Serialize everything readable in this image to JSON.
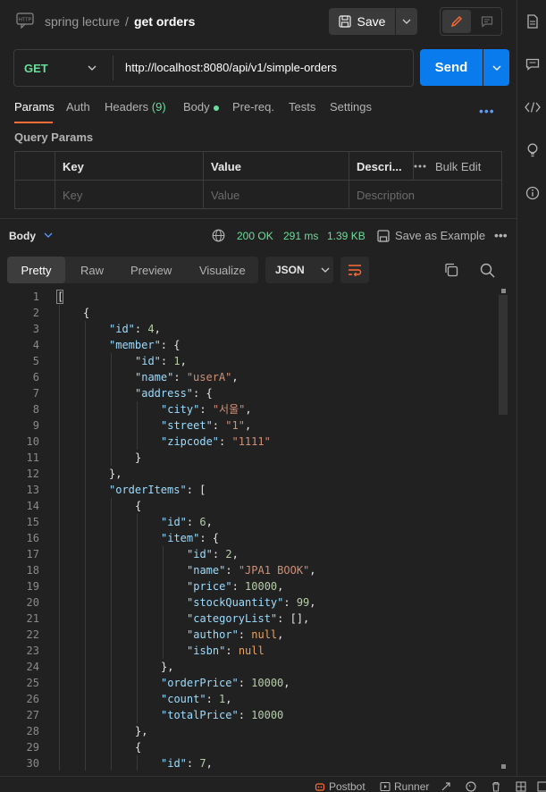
{
  "header": {
    "breadcrumb_collection": "spring lecture",
    "breadcrumb_sep": "/",
    "request_name": "get orders",
    "save_label": "Save",
    "http_badge": "HTTP"
  },
  "request": {
    "method": "GET",
    "url": "http://localhost:8080/api/v1/simple-orders",
    "send_label": "Send",
    "tabs": [
      {
        "label": "Params",
        "active": true
      },
      {
        "label": "Auth"
      },
      {
        "label": "Headers",
        "count": "(9)"
      },
      {
        "label": "Body"
      },
      {
        "label": "Pre-req."
      },
      {
        "label": "Tests"
      },
      {
        "label": "Settings"
      }
    ],
    "more": "•••"
  },
  "query_params": {
    "title": "Query Params",
    "headers": [
      "Key",
      "Value",
      "Descri..."
    ],
    "bulk_edit": "Bulk Edit",
    "placeholders": [
      "Key",
      "Value",
      "Description"
    ]
  },
  "response": {
    "section_label": "Body",
    "status": "200 OK",
    "time": "291 ms",
    "size": "1.39 KB",
    "save_example": "Save as Example",
    "more": "•••",
    "view_tabs": [
      "Pretty",
      "Raw",
      "Preview",
      "Visualize"
    ],
    "format": "JSON"
  },
  "code_lines": [
    {
      "num": "1",
      "indent": 0,
      "parts": [
        {
          "t": "[",
          "c": "p"
        }
      ]
    },
    {
      "num": "2",
      "indent": 1,
      "parts": [
        {
          "t": "{",
          "c": "p"
        }
      ]
    },
    {
      "num": "3",
      "indent": 2,
      "parts": [
        {
          "t": "\"id\"",
          "c": "k"
        },
        {
          "t": ": ",
          "c": "p"
        },
        {
          "t": "4",
          "c": "n"
        },
        {
          "t": ",",
          "c": "p"
        }
      ]
    },
    {
      "num": "4",
      "indent": 2,
      "parts": [
        {
          "t": "\"member\"",
          "c": "k"
        },
        {
          "t": ": {",
          "c": "p"
        }
      ]
    },
    {
      "num": "5",
      "indent": 3,
      "parts": [
        {
          "t": "\"id\"",
          "c": "k"
        },
        {
          "t": ": ",
          "c": "p"
        },
        {
          "t": "1",
          "c": "n"
        },
        {
          "t": ",",
          "c": "p"
        }
      ]
    },
    {
      "num": "6",
      "indent": 3,
      "parts": [
        {
          "t": "\"name\"",
          "c": "k"
        },
        {
          "t": ": ",
          "c": "p"
        },
        {
          "t": "\"userA\"",
          "c": "s"
        },
        {
          "t": ",",
          "c": "p"
        }
      ]
    },
    {
      "num": "7",
      "indent": 3,
      "parts": [
        {
          "t": "\"address\"",
          "c": "k"
        },
        {
          "t": ": {",
          "c": "p"
        }
      ]
    },
    {
      "num": "8",
      "indent": 4,
      "parts": [
        {
          "t": "\"city\"",
          "c": "k"
        },
        {
          "t": ": ",
          "c": "p"
        },
        {
          "t": "\"서울\"",
          "c": "s"
        },
        {
          "t": ",",
          "c": "p"
        }
      ]
    },
    {
      "num": "9",
      "indent": 4,
      "parts": [
        {
          "t": "\"street\"",
          "c": "k"
        },
        {
          "t": ": ",
          "c": "p"
        },
        {
          "t": "\"1\"",
          "c": "s"
        },
        {
          "t": ",",
          "c": "p"
        }
      ]
    },
    {
      "num": "10",
      "indent": 4,
      "parts": [
        {
          "t": "\"zipcode\"",
          "c": "k"
        },
        {
          "t": ": ",
          "c": "p"
        },
        {
          "t": "\"1111\"",
          "c": "s"
        }
      ]
    },
    {
      "num": "11",
      "indent": 3,
      "parts": [
        {
          "t": "}",
          "c": "p"
        }
      ]
    },
    {
      "num": "12",
      "indent": 2,
      "parts": [
        {
          "t": "},",
          "c": "p"
        }
      ]
    },
    {
      "num": "13",
      "indent": 2,
      "parts": [
        {
          "t": "\"orderItems\"",
          "c": "k"
        },
        {
          "t": ": [",
          "c": "p"
        }
      ]
    },
    {
      "num": "14",
      "indent": 3,
      "parts": [
        {
          "t": "{",
          "c": "p"
        }
      ]
    },
    {
      "num": "15",
      "indent": 4,
      "parts": [
        {
          "t": "\"id\"",
          "c": "k"
        },
        {
          "t": ": ",
          "c": "p"
        },
        {
          "t": "6",
          "c": "n"
        },
        {
          "t": ",",
          "c": "p"
        }
      ]
    },
    {
      "num": "16",
      "indent": 4,
      "parts": [
        {
          "t": "\"item\"",
          "c": "k"
        },
        {
          "t": ": {",
          "c": "p"
        }
      ]
    },
    {
      "num": "17",
      "indent": 5,
      "parts": [
        {
          "t": "\"id\"",
          "c": "k"
        },
        {
          "t": ": ",
          "c": "p"
        },
        {
          "t": "2",
          "c": "n"
        },
        {
          "t": ",",
          "c": "p"
        }
      ]
    },
    {
      "num": "18",
      "indent": 5,
      "parts": [
        {
          "t": "\"name\"",
          "c": "k"
        },
        {
          "t": ": ",
          "c": "p"
        },
        {
          "t": "\"JPA1 BOOK\"",
          "c": "s"
        },
        {
          "t": ",",
          "c": "p"
        }
      ]
    },
    {
      "num": "19",
      "indent": 5,
      "parts": [
        {
          "t": "\"price\"",
          "c": "k"
        },
        {
          "t": ": ",
          "c": "p"
        },
        {
          "t": "10000",
          "c": "n"
        },
        {
          "t": ",",
          "c": "p"
        }
      ]
    },
    {
      "num": "20",
      "indent": 5,
      "parts": [
        {
          "t": "\"stockQuantity\"",
          "c": "k"
        },
        {
          "t": ": ",
          "c": "p"
        },
        {
          "t": "99",
          "c": "n"
        },
        {
          "t": ",",
          "c": "p"
        }
      ]
    },
    {
      "num": "21",
      "indent": 5,
      "parts": [
        {
          "t": "\"categoryList\"",
          "c": "k"
        },
        {
          "t": ": [],",
          "c": "p"
        }
      ]
    },
    {
      "num": "22",
      "indent": 5,
      "parts": [
        {
          "t": "\"author\"",
          "c": "k"
        },
        {
          "t": ": ",
          "c": "p"
        },
        {
          "t": "null",
          "c": "nl"
        },
        {
          "t": ",",
          "c": "p"
        }
      ]
    },
    {
      "num": "23",
      "indent": 5,
      "parts": [
        {
          "t": "\"isbn\"",
          "c": "k"
        },
        {
          "t": ": ",
          "c": "p"
        },
        {
          "t": "null",
          "c": "nl"
        }
      ]
    },
    {
      "num": "24",
      "indent": 4,
      "parts": [
        {
          "t": "},",
          "c": "p"
        }
      ]
    },
    {
      "num": "25",
      "indent": 4,
      "parts": [
        {
          "t": "\"orderPrice\"",
          "c": "k"
        },
        {
          "t": ": ",
          "c": "p"
        },
        {
          "t": "10000",
          "c": "n"
        },
        {
          "t": ",",
          "c": "p"
        }
      ]
    },
    {
      "num": "26",
      "indent": 4,
      "parts": [
        {
          "t": "\"count\"",
          "c": "k"
        },
        {
          "t": ": ",
          "c": "p"
        },
        {
          "t": "1",
          "c": "n"
        },
        {
          "t": ",",
          "c": "p"
        }
      ]
    },
    {
      "num": "27",
      "indent": 4,
      "parts": [
        {
          "t": "\"totalPrice\"",
          "c": "k"
        },
        {
          "t": ": ",
          "c": "p"
        },
        {
          "t": "10000",
          "c": "n"
        }
      ]
    },
    {
      "num": "28",
      "indent": 3,
      "parts": [
        {
          "t": "},",
          "c": "p"
        }
      ]
    },
    {
      "num": "29",
      "indent": 3,
      "parts": [
        {
          "t": "{",
          "c": "p"
        }
      ]
    },
    {
      "num": "30",
      "indent": 4,
      "parts": [
        {
          "t": "\"id\"",
          "c": "k"
        },
        {
          "t": ": ",
          "c": "p"
        },
        {
          "t": "7",
          "c": "n"
        },
        {
          "t": ",",
          "c": "p"
        }
      ]
    }
  ],
  "footer": {
    "postbot": "Postbot",
    "runner": "Runner"
  },
  "colors": {
    "accent_orange": "#ff6c37",
    "send_blue": "#097bed",
    "status_green": "#6bdd9a",
    "json_key": "#9cdcfe",
    "json_string": "#ce9178",
    "json_number": "#b5cea8",
    "json_null": "#e8a462"
  }
}
